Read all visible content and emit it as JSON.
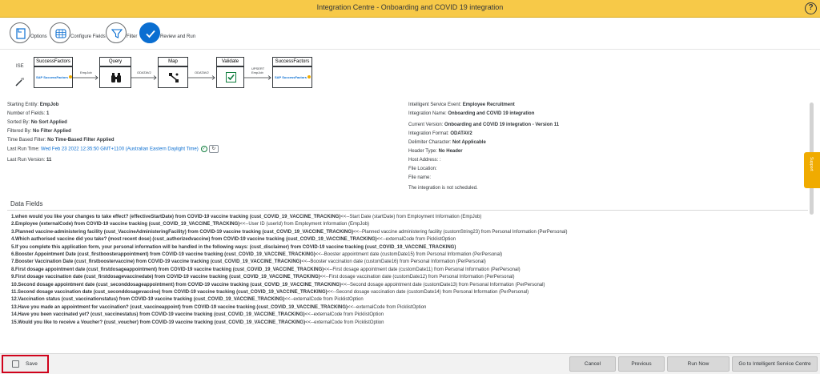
{
  "titlebar": {
    "title": "Integration Centre - Onboarding and COVID 19 integration",
    "help": "?"
  },
  "wizard": {
    "steps": [
      {
        "label": "Options"
      },
      {
        "label": "Configure Fields"
      },
      {
        "label": "Filter"
      },
      {
        "label": "Review and Run"
      }
    ]
  },
  "flow": {
    "ise": "ISE",
    "nodes": [
      {
        "title": "SuccessFactors",
        "logo": "SAP SuccessFactors"
      },
      {
        "title": "Query"
      },
      {
        "title": "Map"
      },
      {
        "title": "Validate"
      },
      {
        "title": "SuccessFactors",
        "logo": "SAP SuccessFactors"
      }
    ],
    "connectors": [
      "EmpJob",
      "ODATAV2",
      "ODATAV2",
      "UPSERT EmpJob"
    ]
  },
  "info_left": {
    "starting_entity_label": "Starting Entity:",
    "starting_entity": "EmpJob",
    "num_fields_label": "Number of Fields:",
    "num_fields": "1",
    "sorted_by_label": "Sorted By:",
    "sorted_by": "No Sort Applied",
    "filtered_by_label": "Filtered By:",
    "filtered_by": "No Filter Applied",
    "time_filter_label": "Time Based Filter:",
    "time_filter": "No Time-Based Filter Applied",
    "last_run_label": "Last Run Time:",
    "last_run": "Wed Feb 23 2022 12:35:50 GMT+1100 (Australian Eastern Daylight Time)",
    "last_run_version_label": "Last Run Version:",
    "last_run_version": "11"
  },
  "info_right": {
    "event_label": "Intelligent Service Event:",
    "event": "Employee Recruitment",
    "name_label": "Integration Name:",
    "name": "Onboarding and COVID 19 integration",
    "version_label": "Current Version:",
    "version": "Onboarding and COVID 19 integration - Version 11",
    "format_label": "Integration Format:",
    "format": "ODATAV2",
    "delimiter_label": "Delimiter Character:",
    "delimiter": "Not Applicable",
    "header_label": "Header Type:",
    "header": "No Header",
    "host_label": "Host Address:",
    "host": ":",
    "file_location_label": "File Location:",
    "file_name_label": "File name:",
    "schedule_note": "The integration is not scheduled."
  },
  "data_fields": {
    "title": "Data Fields",
    "items": [
      {
        "bold": "1.when would you like your changes to take effect? (effectiveStartDate) from COVID-19 vaccine tracking (cust_COVID_19_VACCINE_TRACKING)",
        "rest": "<<--Start Date (startDate) from Employment Information (EmpJob)"
      },
      {
        "bold": "2.Employee (externalCode) from COVID-19 vaccine tracking (cust_COVID_19_VACCINE_TRACKING)",
        "rest": "<<--User ID (userId) from Employment Information (EmpJob)"
      },
      {
        "bold": "3.Planned vaccine-administering facility (cust_VaccineAdministeringFacility) from COVID-19 vaccine tracking (cust_COVID_19_VACCINE_TRACKING)",
        "rest": "<<--Planned vaccine administering facility (customString23) from Personal Information (PerPersonal)"
      },
      {
        "bold": "4.Which authorised vaccine did you take? (most recent dose) (cust_authorizedvaccine) from COVID-19 vaccine tracking (cust_COVID_19_VACCINE_TRACKING)",
        "rest": "<<--externalCode from PicklistOption"
      },
      {
        "bold": "5.If you complete this application form, your personal information will be handled in the following ways: (cust_disclaimer) from COVID-19 vaccine tracking (cust_COVID_19_VACCINE_TRACKING)",
        "rest": ""
      },
      {
        "bold": "6.Booster Appointment Date (cust_firstboosterappointment) from COVID-19 vaccine tracking (cust_COVID_19_VACCINE_TRACKING)",
        "rest": "<<--Booster appointment date (customDate15) from Personal Information (PerPersonal)"
      },
      {
        "bold": "7.Booster Vaccination Date (cust_firstboostervaccine) from COVID-19 vaccine tracking (cust_COVID_19_VACCINE_TRACKING)",
        "rest": "<<--Booster vaccination date (customDate16) from Personal Information (PerPersonal)"
      },
      {
        "bold": "8.First dosage appointment date (cust_firstdosageappointment) from COVID-19 vaccine tracking (cust_COVID_19_VACCINE_TRACKING)",
        "rest": "<<--First dosage appointment date (customDate11) from Personal Information (PerPersonal)"
      },
      {
        "bold": "9.First dosage vaccination date (cust_firstdosagevaccinedate) from COVID-19 vaccine tracking (cust_COVID_19_VACCINE_TRACKING)",
        "rest": "<<--First dosage vaccination date (customDate12) from Personal Information (PerPersonal)"
      },
      {
        "bold": "10.Second dosage appointment date (cust_seconddosageappointment) from COVID-19 vaccine tracking (cust_COVID_19_VACCINE_TRACKING)",
        "rest": "<<--Second dosage appointment date (customDate13) from Personal Information (PerPersonal)"
      },
      {
        "bold": "11.Second dosage vaccination date (cust_seconddosagevaccine) from COVID-19 vaccine tracking (cust_COVID_19_VACCINE_TRACKING)",
        "rest": "<<--Second dosage vaccination date (customDate14) from Personal Information (PerPersonal)"
      },
      {
        "bold": "12.Vaccination status (cust_vaccinationstatus) from COVID-19 vaccine tracking (cust_COVID_19_VACCINE_TRACKING)",
        "rest": "<<--externalCode from PicklistOption"
      },
      {
        "bold": "13.Have you made an appointment for vaccination? (cust_vaccineappoint) from COVID-19 vaccine tracking (cust_COVID_19_VACCINE_TRACKING)",
        "rest": "<<--externalCode from PicklistOption"
      },
      {
        "bold": "14.Have you been vaccinated yet? (cust_vaccinestatus) from COVID-19 vaccine tracking (cust_COVID_19_VACCINE_TRACKING)",
        "rest": "<<--externalCode from PicklistOption"
      },
      {
        "bold": "15.Would you like to receive a Voucher? (cust_voucher) from COVID-19 vaccine tracking (cust_COVID_19_VACCINE_TRACKING)",
        "rest": "<<--externalCode from PicklistOption"
      }
    ]
  },
  "support": "Support",
  "footer": {
    "save": "Save",
    "cancel": "Cancel",
    "previous": "Previous",
    "run_now": "Run Now",
    "go_to": "Go to Intelligent Service Centre"
  }
}
